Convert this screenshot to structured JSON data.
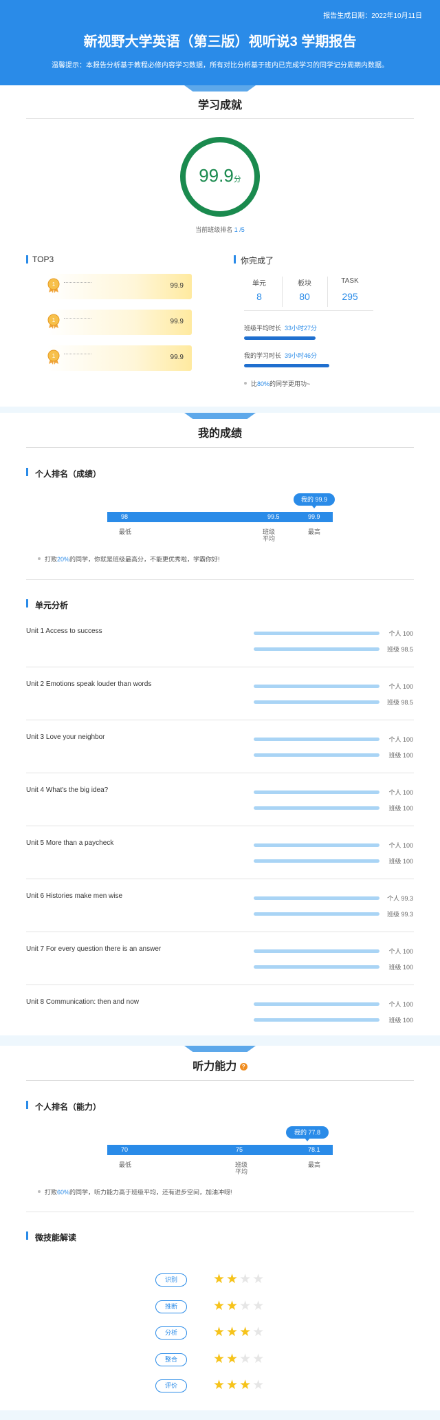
{
  "header": {
    "date": "报告生成日期：2022年10月11日",
    "title": "新视野大学英语（第三版）视听说3 学期报告",
    "tip": "温馨提示：本报告分析基于教程必修内容学习数据，所有对比分析基于班内已完成学习的同学记分周期内数据。"
  },
  "achievement": {
    "title": "学习成就",
    "score": "99.9",
    "score_unit": "分",
    "rank_label": "当前班级排名",
    "rank_value": "1 /5",
    "top3_title": "TOP3",
    "top3": [
      {
        "medal": "1",
        "value": "99.9"
      },
      {
        "medal": "1",
        "value": "99.9"
      },
      {
        "medal": "1",
        "value": "99.9"
      }
    ],
    "completed_title": "你完成了",
    "stats": [
      {
        "label": "单元",
        "value": "8"
      },
      {
        "label": "板块",
        "value": "80"
      },
      {
        "label": "TASK",
        "value": "295"
      }
    ],
    "class_avg_label": "班级平均时长",
    "class_avg_value": "33小时27分",
    "class_avg_fraction": 0.84,
    "my_time_label": "我的学习时长",
    "my_time_value": "39小时46分",
    "my_time_fraction": 1.0,
    "compare_prefix": "比",
    "compare_pct": "80%",
    "compare_suffix": "的同学更用功~"
  },
  "grades": {
    "title": "我的成绩",
    "rank_title": "个人排名（成绩）",
    "bubble": "我的 99.9",
    "low": "98",
    "avg": "99.5",
    "high": "99.9",
    "low_label": "最低",
    "avg_label": "班级平均",
    "high_label": "最高",
    "note_prefix": "打败",
    "note_pct": "20%",
    "note_suffix": "的同学，你就是班级最高分，不能更优秀啦，学霸你好!",
    "unit_title": "单元分析",
    "units": [
      {
        "name": "Unit 1 Access to success",
        "personal": "个人 100",
        "class": "班级 98.5"
      },
      {
        "name": "Unit 2 Emotions speak louder than words",
        "personal": "个人 100",
        "class": "班级 98.5"
      },
      {
        "name": "Unit 3 Love your neighbor",
        "personal": "个人 100",
        "class": "班级 100"
      },
      {
        "name": "Unit 4 What's the big idea?",
        "personal": "个人 100",
        "class": "班级 100"
      },
      {
        "name": "Unit 5 More than a paycheck",
        "personal": "个人 100",
        "class": "班级 100"
      },
      {
        "name": "Unit 6 Histories make men wise",
        "personal": "个人 99.3",
        "class": "班级 99.3"
      },
      {
        "name": "Unit 7 For every question there is an answer",
        "personal": "个人 100",
        "class": "班级 100"
      },
      {
        "name": "Unit 8 Communication: then and now",
        "personal": "个人 100",
        "class": "班级 100"
      }
    ]
  },
  "listening": {
    "title": "听力能力",
    "qmark": "?",
    "rank_title": "个人排名（能力）",
    "bubble": "我的 77.8",
    "low": "70",
    "avg": "75",
    "high": "78.1",
    "low_label": "最低",
    "avg_label": "班级平均",
    "high_label": "最高",
    "note_prefix": "打败",
    "note_pct": "60%",
    "note_suffix": "的同学，听力能力高于班级平均，还有进步空间，加油冲呀!",
    "skills_title": "微技能解读",
    "skills": [
      {
        "label": "识别",
        "stars": 2
      },
      {
        "label": "推断",
        "stars": 2
      },
      {
        "label": "分析",
        "stars": 3
      },
      {
        "label": "整合",
        "stars": 2
      },
      {
        "label": "评价",
        "stars": 3
      }
    ]
  },
  "colors": {
    "accent": "#2a8be8",
    "score": "#1a8a4e",
    "star": "#f6c31b"
  }
}
